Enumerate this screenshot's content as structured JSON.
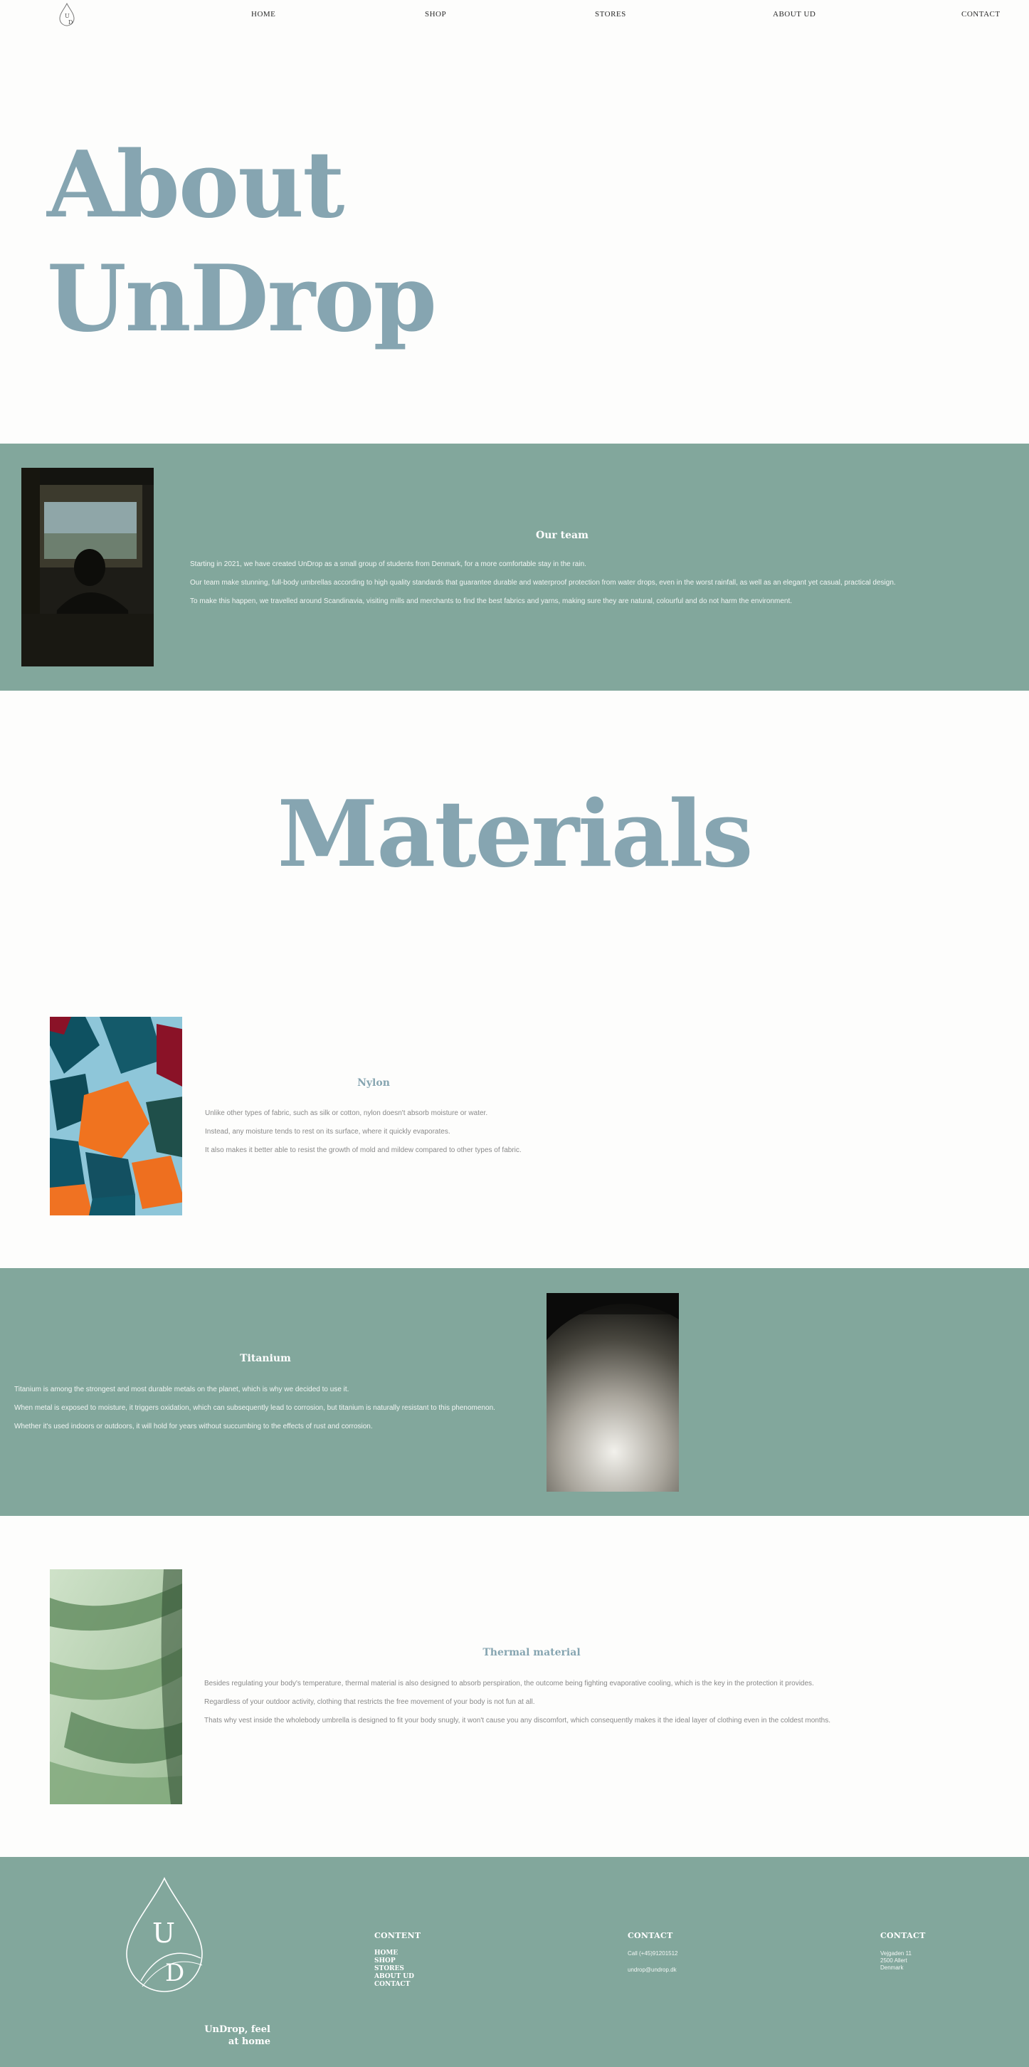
{
  "nav": {
    "logo_letters": "UD",
    "items": [
      {
        "label": "HOME"
      },
      {
        "label": "SHOP"
      },
      {
        "label": "STORES"
      },
      {
        "label": "ABOUT UD"
      },
      {
        "label": "CONTACT"
      }
    ]
  },
  "hero": {
    "title_line1": "About",
    "title_line2": "UnDrop"
  },
  "team": {
    "title": "Our team",
    "paragraphs": [
      "Starting in 2021, we have created UnDrop as a small group of students from Denmark, for a more comfortable stay in the rain.",
      "Our team make stunning, full-body umbrellas according to high quality standards that guarantee durable and waterproof protection from water drops, even in the worst rainfall, as well as an elegant yet casual, practical design.",
      "To make this happen, we travelled around Scandinavia, visiting mills and merchants to find the best fabrics and yarns, making sure they are natural, colourful and do not harm the environment."
    ]
  },
  "materials": {
    "heading": "Materials",
    "nylon": {
      "title": "Nylon",
      "paragraphs": [
        "Unlike other types of fabric, such as silk or cotton, nylon doesn't absorb moisture or water.",
        "Instead, any moisture tends to rest on its surface, where it quickly evaporates.",
        "It also makes it better able to resist the growth of mold and mildew compared to other types of fabric."
      ]
    },
    "titanium": {
      "title": "Titanium",
      "paragraphs": [
        "Titanium is among the strongest and most durable metals on the planet, which is why we decided to use it.",
        "When metal is exposed to moisture, it triggers oxidation, which can subsequently lead to corrosion, but titanium is naturally resistant to this phenomenon.",
        "Whether it's used indoors or outdoors, it will hold for years without succumbing to the effects of rust and corrosion."
      ]
    },
    "thermal": {
      "title": "Thermal material",
      "paragraphs": [
        "Besides regulating your body's temperature, thermal material is also designed to absorb perspiration, the outcome being fighting evaporative cooling, which is the key in the protection it provides.",
        "Regardless of your outdoor activity, clothing that restricts the free movement of your body is not fun at all.",
        "Thats why vest inside the wholebody umbrella is designed to fit your body snugly, it won't cause you any discomfort, which consequently makes it the ideal layer of clothing even in the coldest months."
      ]
    }
  },
  "footer": {
    "logo_letters_top": "U",
    "logo_letters_bottom": "D",
    "tagline_line1": "UnDrop, feel",
    "tagline_line2": "at home",
    "content_title": "CONTENT",
    "links": [
      "HOME",
      "SHOP",
      "STORES",
      "ABOUT UD",
      "CONTACT"
    ],
    "contact1_title": "CONTACT",
    "phone": "Call (+45)91201512",
    "email": "undrop@undrop.dk",
    "contact2_title": "CONTACT",
    "address_line1": "Vejgaden 11",
    "address_line2": "2500 Allert",
    "address_line3": "Denmark"
  },
  "colors": {
    "band": "#82a79c",
    "heading_blue": "#86a5b1",
    "background": "#fdfdfc"
  }
}
